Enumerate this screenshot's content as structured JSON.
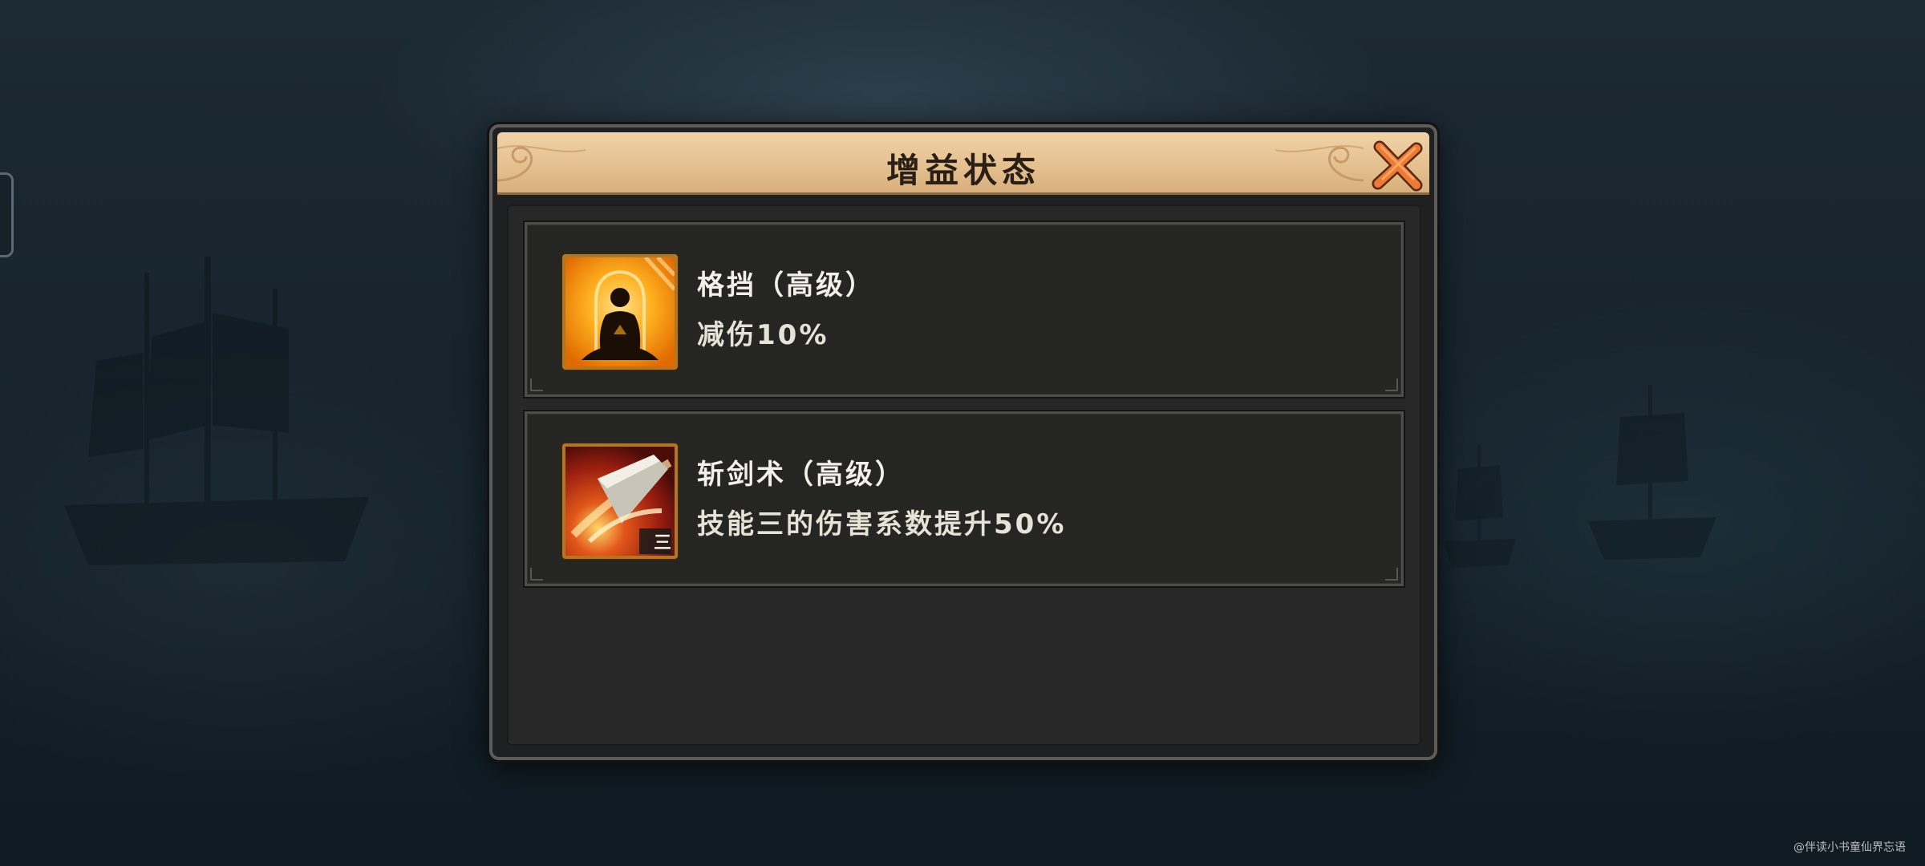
{
  "dialog": {
    "title": "增益状态",
    "close_icon": "close-x-icon"
  },
  "buffs": [
    {
      "name": "格挡（高级）",
      "description": "减伤10%",
      "icon": "meditating-monk-icon"
    },
    {
      "name": "斩剑术（高级）",
      "description": "技能三的伤害系数提升50%",
      "icon": "sword-slash-icon",
      "icon_badge": "三"
    }
  ],
  "watermark": "@伴读小书童仙界忘语",
  "colors": {
    "header_bg": "#e7c495",
    "icon_border": "#b07824",
    "close_orange": "#e8682a"
  }
}
